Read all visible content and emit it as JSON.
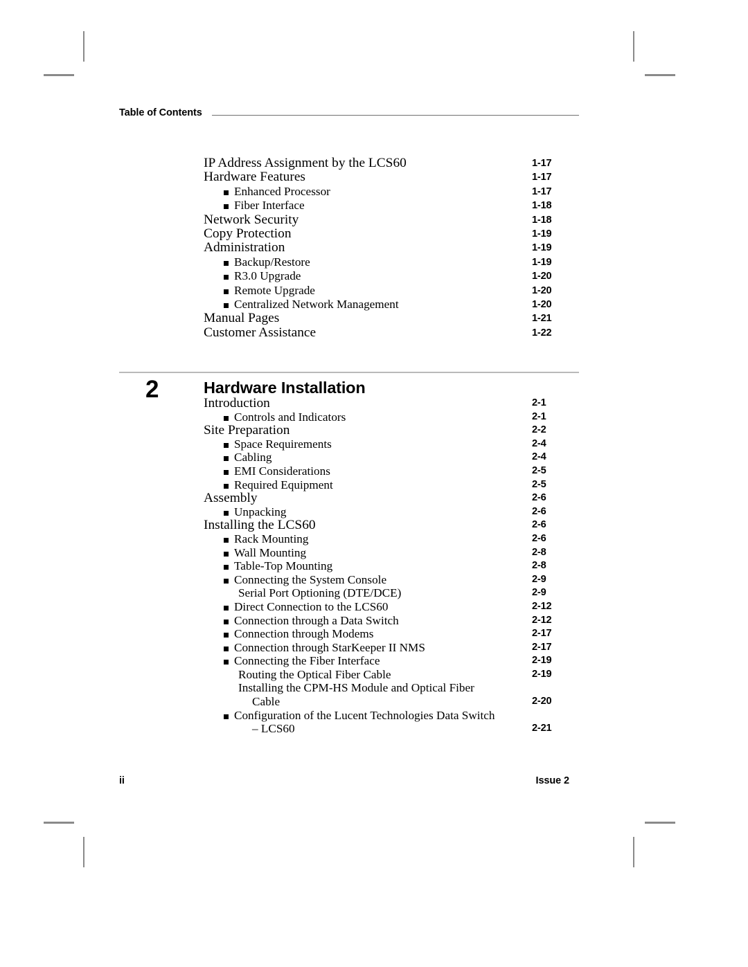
{
  "header": {
    "title": "Table of Contents"
  },
  "footer": {
    "page_number": "ii",
    "issue": "Issue 2"
  },
  "chapter": {
    "number": "2",
    "title": "Hardware Installation"
  },
  "toc_continued": [
    {
      "level": 1,
      "label": "IP Address Assignment by the LCS60",
      "page": "1-17"
    },
    {
      "level": 1,
      "label": "Hardware Features",
      "page": "1-17"
    },
    {
      "level": 2,
      "label": "Enhanced Processor",
      "page": "1-17"
    },
    {
      "level": 2,
      "label": "Fiber Interface",
      "page": "1-18"
    },
    {
      "level": 1,
      "label": "Network Security",
      "page": "1-18"
    },
    {
      "level": 1,
      "label": "Copy Protection",
      "page": "1-19"
    },
    {
      "level": 1,
      "label": "Administration",
      "page": "1-19"
    },
    {
      "level": 2,
      "label": "Backup/Restore",
      "page": "1-19"
    },
    {
      "level": 2,
      "label": "R3.0 Upgrade",
      "page": "1-20"
    },
    {
      "level": 2,
      "label": "Remote Upgrade",
      "page": "1-20"
    },
    {
      "level": 2,
      "label": "Centralized Network Management",
      "page": "1-20"
    },
    {
      "level": 1,
      "label": "Manual Pages",
      "page": "1-21"
    },
    {
      "level": 1,
      "label": "Customer Assistance",
      "page": "1-22"
    }
  ],
  "toc_chapter_2": [
    {
      "level": 1,
      "label": "Introduction",
      "page": "2-1"
    },
    {
      "level": 2,
      "label": "Controls and Indicators",
      "page": "2-1"
    },
    {
      "level": 1,
      "label": "Site Preparation",
      "page": "2-2"
    },
    {
      "level": 2,
      "label": "Space Requirements",
      "page": "2-4"
    },
    {
      "level": 2,
      "label": "Cabling",
      "page": "2-4"
    },
    {
      "level": 2,
      "label": "EMI Considerations",
      "page": "2-5"
    },
    {
      "level": 2,
      "label": "Required Equipment",
      "page": "2-5"
    },
    {
      "level": 1,
      "label": "Assembly",
      "page": "2-6"
    },
    {
      "level": 2,
      "label": "Unpacking",
      "page": "2-6"
    },
    {
      "level": 1,
      "label": "Installing the LCS60",
      "page": "2-6"
    },
    {
      "level": 2,
      "label": "Rack Mounting",
      "page": "2-6"
    },
    {
      "level": 2,
      "label": "Wall Mounting",
      "page": "2-8"
    },
    {
      "level": 2,
      "label": "Table-Top Mounting",
      "page": "2-8"
    },
    {
      "level": 2,
      "label": "Connecting the System Console",
      "page": "2-9"
    },
    {
      "level": 3,
      "label": "Serial Port Optioning (DTE/DCE)",
      "page": "2-9"
    },
    {
      "level": 2,
      "label": "Direct Connection to the LCS60",
      "page": "2-12"
    },
    {
      "level": 2,
      "label": "Connection through a Data Switch",
      "page": "2-12"
    },
    {
      "level": 2,
      "label": "Connection through Modems",
      "page": "2-17"
    },
    {
      "level": 2,
      "label": "Connection through StarKeeper II NMS",
      "page": "2-17"
    },
    {
      "level": 2,
      "label": "Connecting the Fiber Interface",
      "page": "2-19"
    },
    {
      "level": 3,
      "label": "Routing the Optical Fiber Cable",
      "page": "2-19"
    },
    {
      "level": 3,
      "label": "Installing the CPM-HS Module and Optical Fiber",
      "page": ""
    },
    {
      "level": 4,
      "label": "Cable",
      "page": "2-20"
    },
    {
      "level": 2,
      "label": "Configuration of the Lucent Technologies Data Switch",
      "page": ""
    },
    {
      "level": 4,
      "label": "– LCS60",
      "page": "2-21"
    }
  ]
}
